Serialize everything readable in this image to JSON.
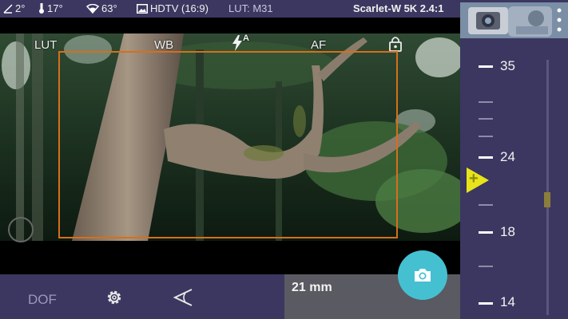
{
  "status": {
    "sun_angle": "2°",
    "temperature": "17°",
    "battery": "63°",
    "format": "HDTV (16:9)",
    "lut": "LUT: M31",
    "camera": "Scarlet-W 5K 2.4:1"
  },
  "overlay": {
    "lut_label": "LUT",
    "wb_label": "WB",
    "flash_mode": "A",
    "af_label": "AF"
  },
  "bottom": {
    "dof_label": "DOF",
    "focal_length": "21 mm"
  },
  "ruler": {
    "labels": [
      "35",
      "24",
      "18",
      "14"
    ],
    "pointer_symbol": "+"
  },
  "colors": {
    "bar": "#3b3760",
    "accent_orange": "#d66f1b",
    "shutter": "#45c0d1",
    "pointer": "#e8e41a"
  }
}
